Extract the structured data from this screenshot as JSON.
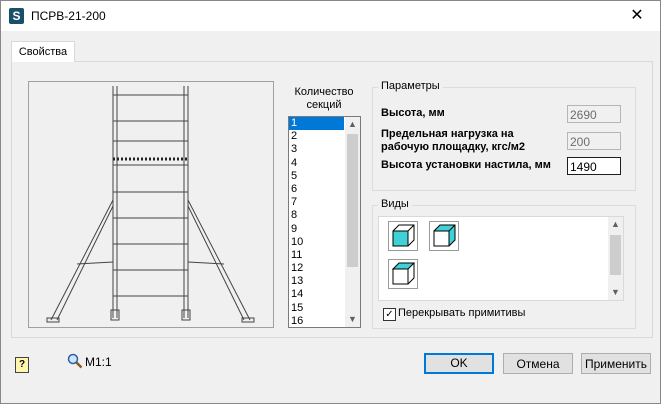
{
  "window": {
    "title": "ПСРВ-21-200",
    "app_icon": "S"
  },
  "tabs": [
    {
      "label": "Свойства",
      "selected": true
    }
  ],
  "sections": {
    "label": "Количество секций",
    "items": [
      "1",
      "2",
      "3",
      "4",
      "5",
      "6",
      "7",
      "8",
      "9",
      "10",
      "11",
      "12",
      "13",
      "14",
      "15",
      "16"
    ],
    "selected": "1"
  },
  "parameters": {
    "title": "Параметры",
    "height_label": "Высота, мм",
    "height_value": "2690",
    "load_label": "Предельная нагрузка на рабочую площадку, кгс/м2",
    "load_value": "200",
    "deck_label": "Высота установки настила, мм",
    "deck_value": "1490"
  },
  "views": {
    "title": "Виды",
    "icons": [
      "front-view-icon",
      "iso-view-icon",
      "top-view-icon"
    ]
  },
  "overlap_checkbox": {
    "label": "Перекрывать примитивы",
    "checked": true
  },
  "footer": {
    "scale": "M1:1",
    "ok": "OK",
    "cancel": "Отмена",
    "apply": "Применить"
  },
  "colors": {
    "accent": "#0078d7",
    "view_cube": "#3fd0d8"
  }
}
